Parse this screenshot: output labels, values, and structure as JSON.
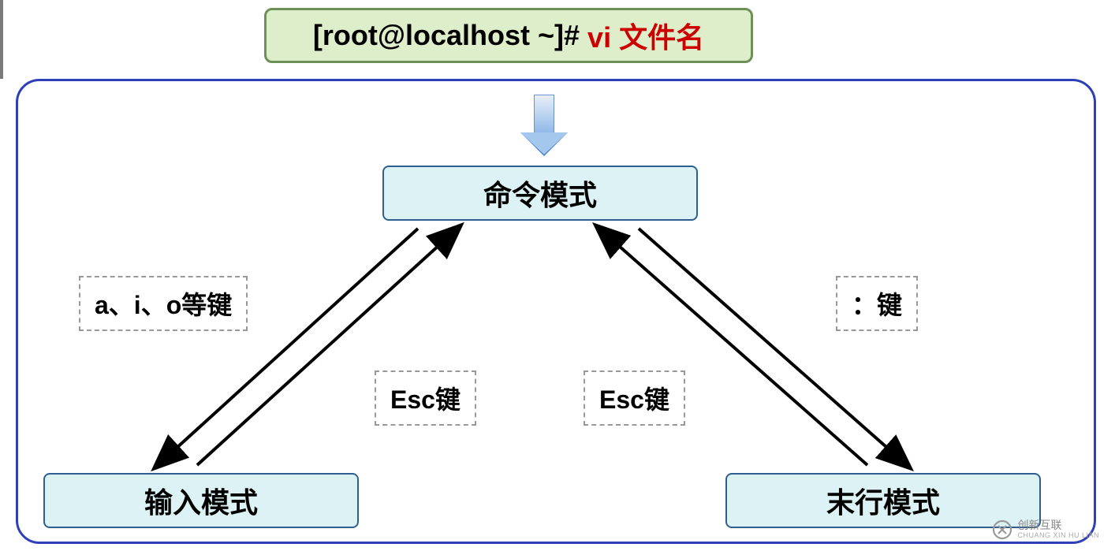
{
  "command": {
    "prompt": "[root@localhost ~]#",
    "cmd": "vi 文件名"
  },
  "modes": {
    "command": "命令模式",
    "input": "输入模式",
    "lastline": "末行模式"
  },
  "labels": {
    "aio": "a、i、o等键",
    "colon": "：键",
    "esc_left": "Esc键",
    "esc_right": "Esc键"
  },
  "watermark": {
    "main": "创新互联",
    "sub": "CHUANG XIN HU LIAN"
  }
}
